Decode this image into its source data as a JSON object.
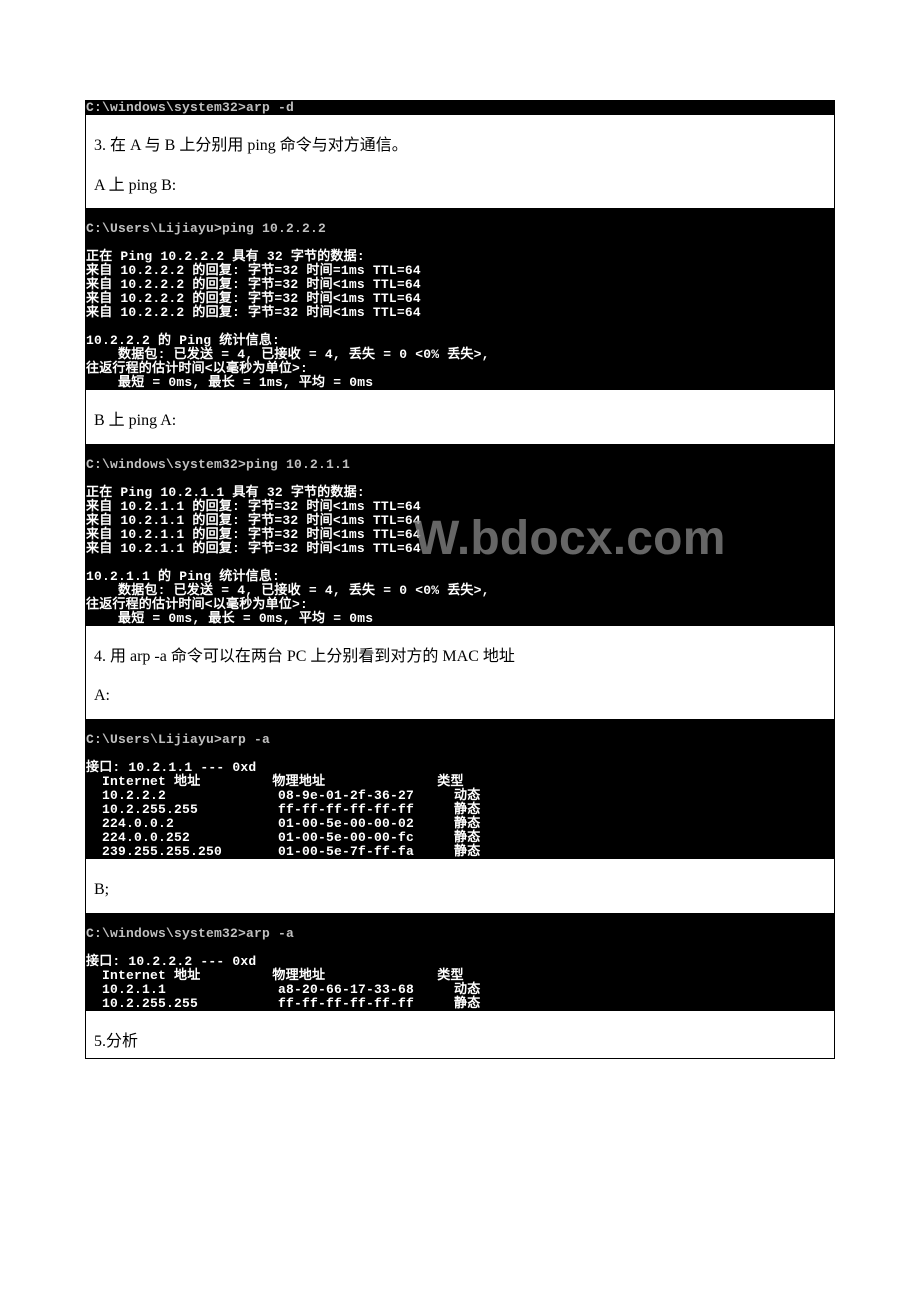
{
  "term1": "C:\\windows\\system32>arp -d",
  "text_step3": "3. 在 A 与 B 上分别用 ping 命令与对方通信。",
  "text_a_ping_b": "A 上 ping B:",
  "term2_prompt": "C:\\Users\\Lijiayu>ping 10.2.2.2",
  "term2_body": "正在 Ping 10.2.2.2 具有 32 字节的数据:\n来自 10.2.2.2 的回复: 字节=32 时间=1ms TTL=64\n来自 10.2.2.2 的回复: 字节=32 时间<1ms TTL=64\n来自 10.2.2.2 的回复: 字节=32 时间<1ms TTL=64\n来自 10.2.2.2 的回复: 字节=32 时间<1ms TTL=64\n\n10.2.2.2 的 Ping 统计信息:\n    数据包: 已发送 = 4, 已接收 = 4, 丢失 = 0 <0% 丢失>,\n往返行程的估计时间<以毫秒为单位>:\n    最短 = 0ms, 最长 = 1ms, 平均 = 0ms",
  "text_b_ping_a": "B 上 ping A:",
  "term3_prompt": "C:\\windows\\system32>ping 10.2.1.1",
  "term3_body": "正在 Ping 10.2.1.1 具有 32 字节的数据:\n来自 10.2.1.1 的回复: 字节=32 时间<1ms TTL=64\n来自 10.2.1.1 的回复: 字节=32 时间<1ms TTL=64\n来自 10.2.1.1 的回复: 字节=32 时间<1ms TTL=64\n来自 10.2.1.1 的回复: 字节=32 时间<1ms TTL=64\n\n10.2.1.1 的 Ping 统计信息:\n    数据包: 已发送 = 4, 已接收 = 4, 丢失 = 0 <0% 丢失>,\n往返行程的估计时间<以毫秒为单位>:\n    最短 = 0ms, 最长 = 0ms, 平均 = 0ms",
  "text_step4": "4. 用 arp -a 命令可以在两台 PC 上分别看到对方的 MAC 地址",
  "text_a": "A:",
  "term4_prompt": "C:\\Users\\Lijiayu>arp -a",
  "term4_body": "接口: 10.2.1.1 --- 0xd\n  Internet 地址         物理地址              类型\n  10.2.2.2              08-9e-01-2f-36-27     动态\n  10.2.255.255          ff-ff-ff-ff-ff-ff     静态\n  224.0.0.2             01-00-5e-00-00-02     静态\n  224.0.0.252           01-00-5e-00-00-fc     静态\n  239.255.255.250       01-00-5e-7f-ff-fa     静态",
  "text_b": "B;",
  "term5_prompt": "C:\\windows\\system32>arp -a",
  "term5_body": "接口: 10.2.2.2 --- 0xd\n  Internet 地址         物理地址              类型\n  10.2.1.1              a8-20-66-17-33-68     动态\n  10.2.255.255          ff-ff-ff-ff-ff-ff     静态",
  "text_step5": "5.分析",
  "watermark_text": "W.bdocx.com"
}
